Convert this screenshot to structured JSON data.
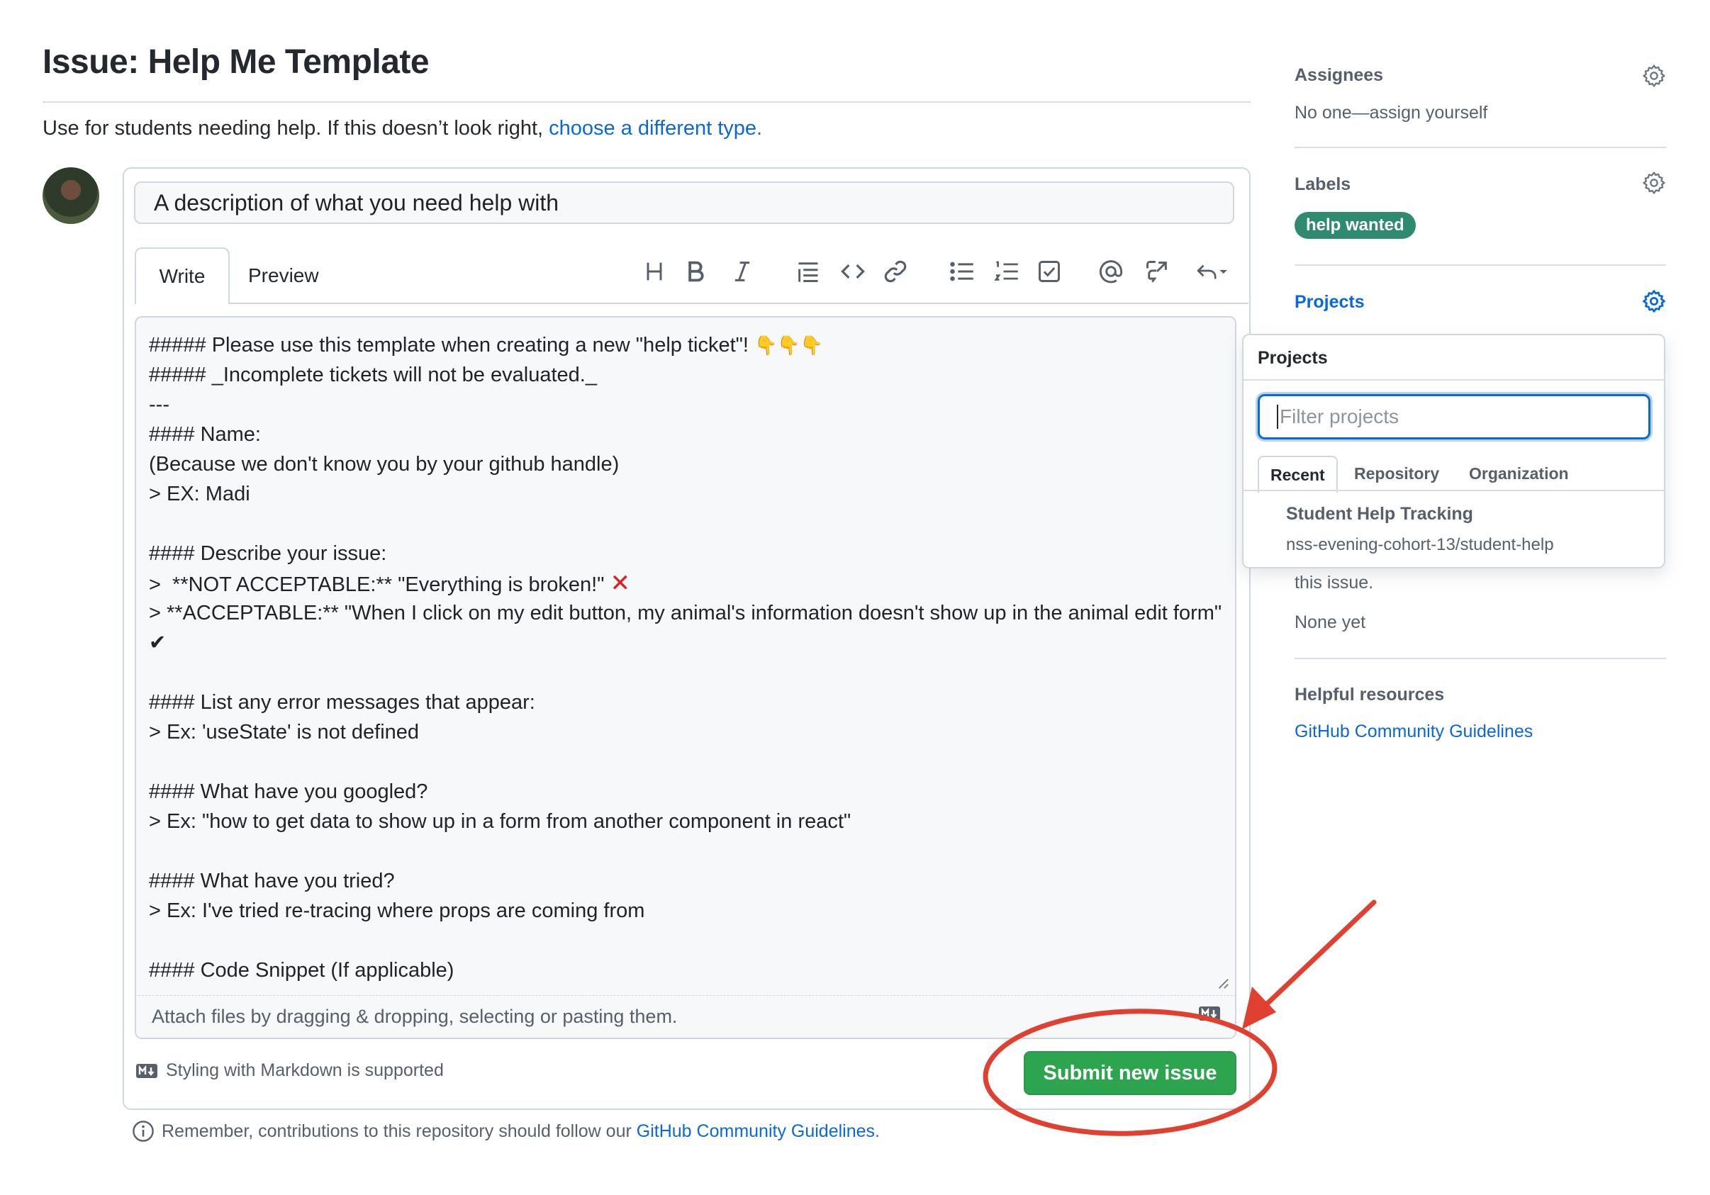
{
  "header": {
    "title": "Issue: Help Me Template",
    "intro_text": "Use for students needing help. If this doesn’t look right,",
    "intro_link": "choose a different type."
  },
  "composer": {
    "title_value": "A description of what you need help with",
    "tabs": {
      "write": "Write",
      "preview": "Preview"
    },
    "toolbar_icons": [
      "heading-icon",
      "bold-icon",
      "italic-icon",
      "quote-icon",
      "code-icon",
      "link-icon",
      "bulleted-list-icon",
      "numbered-list-icon",
      "task-list-icon",
      "mention-icon",
      "cross-reference-icon",
      "reply-icon"
    ],
    "body": {
      "l1": "##### Please use this template when creating a new \"help ticket\"! ",
      "l1_emoji": "👇👇👇",
      "l2": "##### _Incomplete tickets will not be evaluated._",
      "l3": "---",
      "l4": "#### Name:",
      "l5": "(Because we don't know you by your github handle)",
      "l6": "> EX: Madi",
      "l8": "#### Describe your issue:",
      "l9": ">  **NOT ACCEPTABLE:** \"Everything is broken!\" ",
      "l9_mark": "✕",
      "l10": ">  **ACCEPTABLE:** \"When I click on my edit button, my animal's information doesn't show up in the animal edit form\" ",
      "l10_mark": "✔",
      "l12": "#### List any error messages that appear:",
      "l13": "> Ex: 'useState' is not defined",
      "l15": "#### What have you googled?",
      "l16": "> Ex: \"how to get data to show up in a form from another component in react\"",
      "l18": "#### What have you tried?",
      "l19": "> Ex: I've tried re-tracing where props are coming from",
      "l21": "#### Code Snippet (If applicable)"
    },
    "attach_text": "Attach files by dragging & dropping, selecting or pasting them.",
    "markdown_note": "Styling with Markdown is supported",
    "submit_label": "Submit new issue"
  },
  "reminder": {
    "text": "Remember, contributions to this repository should follow our",
    "link": "GitHub Community Guidelines",
    "end": "."
  },
  "sidebar": {
    "assignees": {
      "heading": "Assignees",
      "value": "No one—assign yourself"
    },
    "labels": {
      "heading": "Labels",
      "pill": "help wanted",
      "pill_color": "#2e8b6e"
    },
    "projects": {
      "heading": "Projects",
      "partial_text": "this issue.",
      "value": "None yet"
    },
    "helpful": {
      "heading": "Helpful resources",
      "link": "GitHub Community Guidelines"
    }
  },
  "projects_popup": {
    "title": "Projects",
    "filter_placeholder": "Filter projects",
    "tabs": [
      "Recent",
      "Repository",
      "Organization"
    ],
    "item": {
      "name": "Student Help Tracking",
      "path": "nss-evening-cohort-13/student-help"
    }
  },
  "colors": {
    "accent": "#0969da",
    "submit": "#2da44e",
    "annotation": "#e0402f"
  }
}
